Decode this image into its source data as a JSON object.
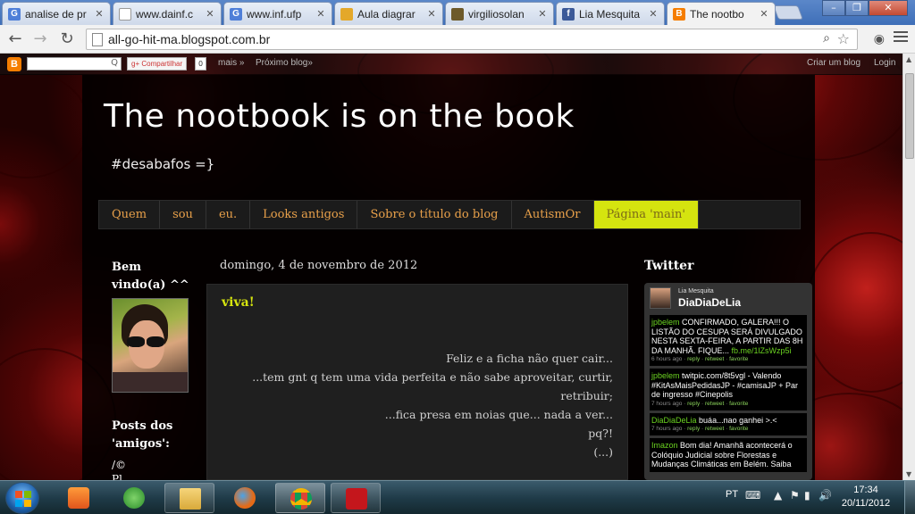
{
  "browser": {
    "tabs": [
      {
        "label": "analise de pr",
        "favicon": "G",
        "color": "#4f7fd8"
      },
      {
        "label": "www.dainf.c",
        "favicon": "",
        "color": "#ffffff"
      },
      {
        "label": "www.inf.ufp",
        "favicon": "G",
        "color": "#4f7fd8"
      },
      {
        "label": "Aula diagrar",
        "favicon": "",
        "color": "#e4a82a"
      },
      {
        "label": "virgiliosolan",
        "favicon": "",
        "color": "#6d5a2a"
      },
      {
        "label": "Lia Mesquita",
        "favicon": "f",
        "color": "#3b5998"
      },
      {
        "label": "The nootbo",
        "favicon": "B",
        "color": "#f57d00"
      }
    ],
    "url": "all-go-hit-ma.blogspot.com.br"
  },
  "bloggerbar": {
    "share_label": "Compartilhar",
    "count": "0",
    "more": "mais »",
    "next_blog": "Próximo blog»",
    "create_blog": "Criar um blog",
    "login": "Login"
  },
  "blog": {
    "title": "The nootbook is on the book",
    "description": "#desabafos =}",
    "pages": [
      "Quem",
      "sou",
      "eu.",
      "Looks antigos",
      "Sobre o título do blog",
      "AutismOr",
      "Página 'main'"
    ],
    "accent": "#d5e40f",
    "sidebar": {
      "welcome": "Bem vindo(a) ^^",
      "friends": "Posts dos 'amigos':",
      "friends_item1": "/©",
      "friends_item2": "Pl"
    },
    "post": {
      "date": "domingo, 4 de novembro de 2012",
      "title": "viva!",
      "lines": [
        "Feliz e a ficha não quer cair...",
        "...tem gnt q tem uma vida perfeita e não sabe aproveitar, curtir, retribuir;",
        "...fica presa em noias que... nada a ver...",
        "pq?!",
        "(...)"
      ]
    },
    "twitter": {
      "heading": "Twitter",
      "profile_name": "Lia Mesquita",
      "profile_user": "DiaDiaDeLia",
      "tweets": [
        {
          "user": "jpbelem",
          "text": "CONFIRMADO, GALERA!!! O LISTÃO DO CESUPA SERÁ DIVULGADO NESTA SEXTA-FEIRA, A PARTIR DAS 8H DA MANHÃ. FIQUE...",
          "link": "fb.me/1lZsWzp5i",
          "time": "6 hours ago",
          "reply": "reply",
          "retweet": "retweet",
          "favorite": "favorite"
        },
        {
          "user": "jpbelem",
          "text": "twitpic.com/8t5vgl - Valendo #KitAsMaisPedidasJP - #camisaJP + Par de ingresso #Cinepolis",
          "link": "",
          "time": "7 hours ago",
          "reply": "reply",
          "retweet": "retweet",
          "favorite": "favorite"
        },
        {
          "user": "DiaDiaDeLia",
          "text": "buáa...nao ganhei >.<",
          "link": "",
          "time": "7 hours ago",
          "reply": "reply",
          "retweet": "retweet",
          "favorite": "favorite"
        },
        {
          "user": "Imazon",
          "text": "Bom dia! Amanhã acontecerá o Colóquio Judicial sobre Florestas e Mudanças Climáticas em Belém. Saiba",
          "link": "",
          "time": "",
          "reply": "",
          "retweet": "",
          "favorite": ""
        }
      ]
    }
  },
  "taskbar": {
    "language": "PT",
    "time": "17:34",
    "date": "20/11/2012"
  }
}
